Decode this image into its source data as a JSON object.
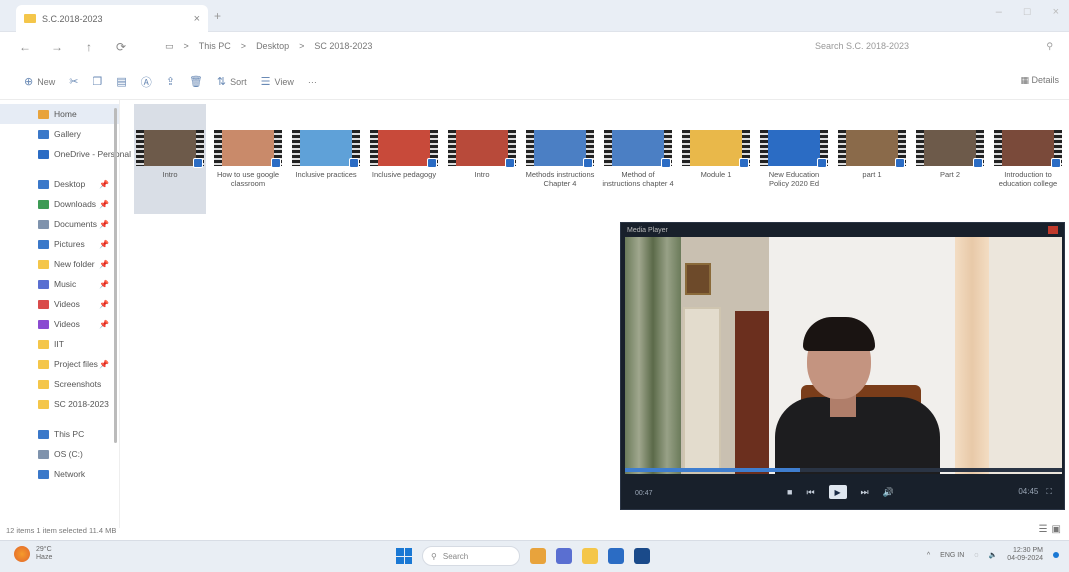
{
  "window": {
    "tab_title": "S.C.2018-2023",
    "tab_close": "×",
    "new_tab": "+",
    "controls": [
      "–",
      "□",
      "×"
    ]
  },
  "nav": {
    "back": "←",
    "forward": "→",
    "up": "↑",
    "refresh": "⟳",
    "path": [
      "This PC",
      "Desktop",
      "SC 2018-2023"
    ],
    "path_sep": ">",
    "search_placeholder": "Search S.C. 2018-2023",
    "search_icon": "search-icon"
  },
  "toolbar": {
    "new_label": "New",
    "sort_label": "Sort",
    "view_label": "View",
    "more_label": "···",
    "details_label": "Details"
  },
  "sidebar": {
    "items": [
      {
        "label": "Home",
        "color": "#e8a33c"
      },
      {
        "label": "Gallery",
        "color": "#3a78c9"
      },
      {
        "label": "OneDrive - Personal",
        "color": "#2b6cc4"
      },
      {
        "label": "Desktop",
        "color": "#3a78c9",
        "pin": "📌"
      },
      {
        "label": "Downloads",
        "color": "#3d9b55",
        "pin": "📌"
      },
      {
        "label": "Documents",
        "color": "#7f93ad",
        "pin": "📌"
      },
      {
        "label": "Pictures",
        "color": "#3a78c9",
        "pin": "📌"
      },
      {
        "label": "New folder",
        "color": "#f4c64a",
        "pin": "📌"
      },
      {
        "label": "Music",
        "color": "#5a6fd1",
        "pin": "📌"
      },
      {
        "label": "Videos",
        "color": "#d94b4b",
        "pin": "📌"
      },
      {
        "label": "Videos",
        "color": "#8a4bd1",
        "pin": "📌"
      },
      {
        "label": "IIT",
        "color": "#f4c64a"
      },
      {
        "label": "Project files",
        "color": "#f4c64a",
        "pin": "📌"
      },
      {
        "label": "Screenshots",
        "color": "#f4c64a"
      },
      {
        "label": "SC 2018-2023",
        "color": "#f4c64a"
      },
      {
        "label": "This PC",
        "color": "#3a78c9"
      },
      {
        "label": "OS (C:)",
        "color": "#7f93ad"
      },
      {
        "label": "Network",
        "color": "#3a78c9"
      }
    ]
  },
  "files": [
    {
      "name": "Intro",
      "frame": "#6d5a4a"
    },
    {
      "name": "How to use google classroom",
      "frame": "#c98a6a"
    },
    {
      "name": "Inclusive practices",
      "frame": "#5fa1d8"
    },
    {
      "name": "Inclusive pedagogy",
      "frame": "#c84a3a"
    },
    {
      "name": "Intro",
      "frame": "#b84a3a"
    },
    {
      "name": "Methods instructions Chapter 4",
      "frame": "#4b7fc4"
    },
    {
      "name": "Method of instructions chapter 4",
      "frame": "#4b7fc4"
    },
    {
      "name": "Module 1",
      "frame": "#e9b84a"
    },
    {
      "name": "New Education Policy 2020 Ed",
      "frame": "#2b6cc4"
    },
    {
      "name": "part 1",
      "frame": "#8a6a4a"
    },
    {
      "name": "Part 2",
      "frame": "#6d5a4a"
    },
    {
      "name": "Introduction to education college",
      "frame": "#7a4a3a"
    }
  ],
  "status": {
    "text": "12 items  1 item selected  11.4 MB"
  },
  "player": {
    "title": "Media Player",
    "progress": 0.4,
    "time_left": "00:47",
    "time_right": "04:45",
    "stop": "■",
    "prev": "⏮",
    "play": "▶",
    "next": "⏭",
    "volume": "🔊"
  },
  "taskbar": {
    "weather_temp": "29°C",
    "weather_text": "Haze",
    "search_label": "Search",
    "apps": [
      {
        "name": "widgets-app",
        "color": "#e8a33c"
      },
      {
        "name": "chat-app",
        "color": "#5a6fd1"
      },
      {
        "name": "file-explorer-app",
        "color": "#f4c64a"
      },
      {
        "name": "store-app",
        "color": "#2b6cc4"
      },
      {
        "name": "media-player-app",
        "color": "#1a4a8a"
      }
    ],
    "lang": "ENG IN",
    "time": "12:30 PM",
    "date": "04-09-2024"
  }
}
